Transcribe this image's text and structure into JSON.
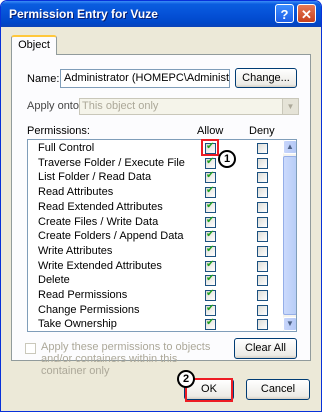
{
  "window": {
    "title": "Permission Entry for Vuze"
  },
  "tab": {
    "label": "Object"
  },
  "name": {
    "label": "Name:",
    "value": "Administrator (HOMEPC\\Administrator)",
    "change_button": "Change..."
  },
  "apply_onto": {
    "label": "Apply onto:",
    "value": "This object only"
  },
  "headers": {
    "permissions": "Permissions:",
    "allow": "Allow",
    "deny": "Deny"
  },
  "permissions": [
    {
      "name": "Full Control",
      "allow": true,
      "deny": false
    },
    {
      "name": "Traverse Folder / Execute File",
      "allow": true,
      "deny": false
    },
    {
      "name": "List Folder / Read Data",
      "allow": true,
      "deny": false
    },
    {
      "name": "Read Attributes",
      "allow": true,
      "deny": false
    },
    {
      "name": "Read Extended Attributes",
      "allow": true,
      "deny": false
    },
    {
      "name": "Create Files / Write Data",
      "allow": true,
      "deny": false
    },
    {
      "name": "Create Folders / Append Data",
      "allow": true,
      "deny": false
    },
    {
      "name": "Write Attributes",
      "allow": true,
      "deny": false
    },
    {
      "name": "Write Extended Attributes",
      "allow": true,
      "deny": false
    },
    {
      "name": "Delete",
      "allow": true,
      "deny": false
    },
    {
      "name": "Read Permissions",
      "allow": true,
      "deny": false
    },
    {
      "name": "Change Permissions",
      "allow": true,
      "deny": false
    },
    {
      "name": "Take Ownership",
      "allow": true,
      "deny": false
    }
  ],
  "apply_within": {
    "label": "Apply these permissions to objects and/or containers within this container only",
    "checked": false
  },
  "buttons": {
    "clear_all": "Clear All",
    "ok": "OK",
    "cancel": "Cancel"
  },
  "annotations": {
    "step1": "1",
    "step2": "2",
    "color": "#ed1c24"
  }
}
